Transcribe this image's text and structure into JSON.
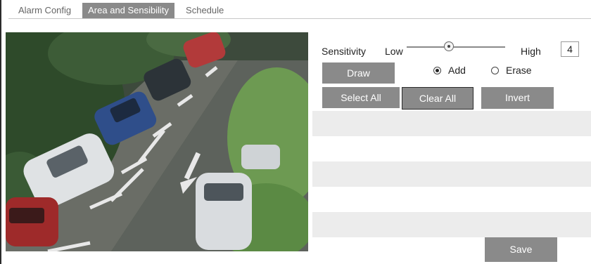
{
  "tabs": [
    {
      "label": "Alarm Config",
      "active": false
    },
    {
      "label": "Area and Sensibility",
      "active": true
    },
    {
      "label": "Schedule",
      "active": false
    }
  ],
  "sensitivity": {
    "label": "Sensitivity",
    "low_label": "Low",
    "high_label": "High",
    "value": "4",
    "min": 1,
    "max": 8
  },
  "draw_button": "Draw",
  "mode": {
    "add_label": "Add",
    "erase_label": "Erase",
    "selected": "add"
  },
  "select_all_button": "Select All",
  "clear_all_button": "Clear All",
  "invert_button": "Invert",
  "save_button": "Save",
  "colors": {
    "button_bg": "#8a8a8a",
    "active_tab_bg": "#8a8a8a",
    "row_shade": "#ececec"
  }
}
